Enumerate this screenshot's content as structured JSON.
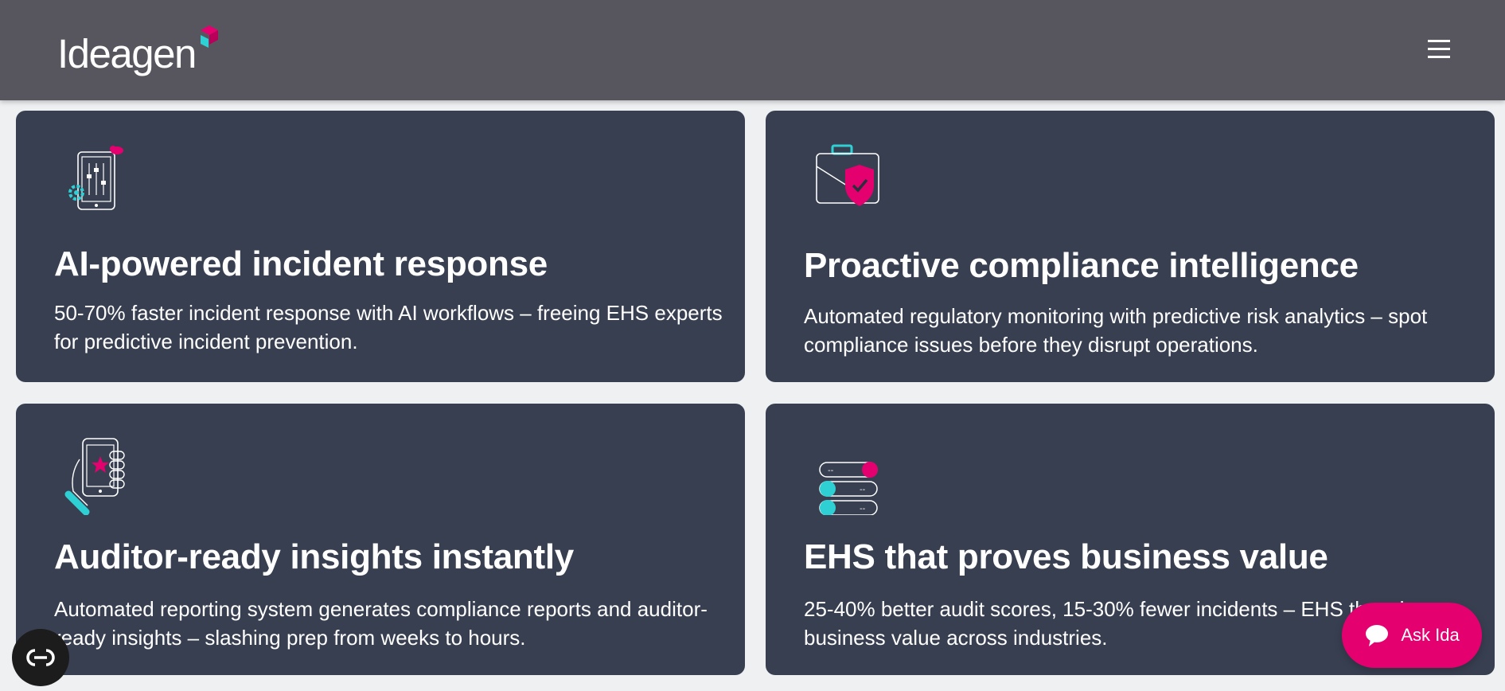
{
  "header": {
    "logo_text": "Ideagen",
    "menu_icon": "hamburger-menu-icon"
  },
  "cards": [
    {
      "icon": "tablet-sliders-gear-icon",
      "title": "AI-powered incident response",
      "description": "50-70% faster incident response with AI workflows – freeing EHS experts for predictive incident prevention."
    },
    {
      "icon": "briefcase-shield-check-icon",
      "title": "Proactive compliance intelligence",
      "description": "Automated regulatory monitoring with predictive risk analytics – spot compliance issues before they disrupt operations."
    },
    {
      "icon": "phone-star-hand-icon",
      "title": "Auditor-ready insights instantly",
      "description": "Automated reporting system generates compliance reports and auditor-ready insights – slashing prep from weeks to hours."
    },
    {
      "icon": "toggle-switches-icon",
      "title": "EHS that proves business value",
      "description": "25-40% better audit scores, 15-30% fewer incidents – EHS that shows business value across industries."
    }
  ],
  "widgets": {
    "ask_label": "Ask Ida",
    "accessibility_icon": "accessibility-toggle-icon"
  },
  "colors": {
    "header_bg": "#57565e",
    "card_bg": "#383f51",
    "page_bg": "#eef0f2",
    "accent_pink": "#e4006f",
    "accent_cyan": "#2fd0d4"
  }
}
